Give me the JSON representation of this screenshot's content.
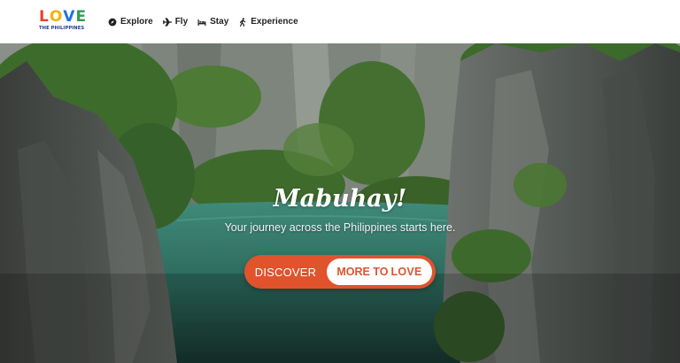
{
  "brand": {
    "logo_letters": [
      "L",
      "O",
      "V",
      "E"
    ],
    "logo_colors": [
      "#e8412f",
      "#f4b400",
      "#1a73e8",
      "#2e9e4f"
    ],
    "logo_subtitle": "THE PHILIPPINES"
  },
  "nav": {
    "items": [
      {
        "label": "Explore",
        "icon": "compass-icon"
      },
      {
        "label": "Fly",
        "icon": "airplane-icon"
      },
      {
        "label": "Stay",
        "icon": "bed-icon"
      },
      {
        "label": "Experience",
        "icon": "walking-person-icon"
      }
    ]
  },
  "hero": {
    "tagline": "Mabuhay!",
    "subtitle": "Your journey across the Philippines starts here.",
    "cta_left": "DISCOVER",
    "cta_right_prefix": "MORE TO",
    "cta_right_brand": "LOVE"
  },
  "colors": {
    "accent": "#e0532d",
    "lagoon": "#2f6b5c",
    "cliff": "#5a5f5a",
    "foliage": "#3f6f2e"
  }
}
